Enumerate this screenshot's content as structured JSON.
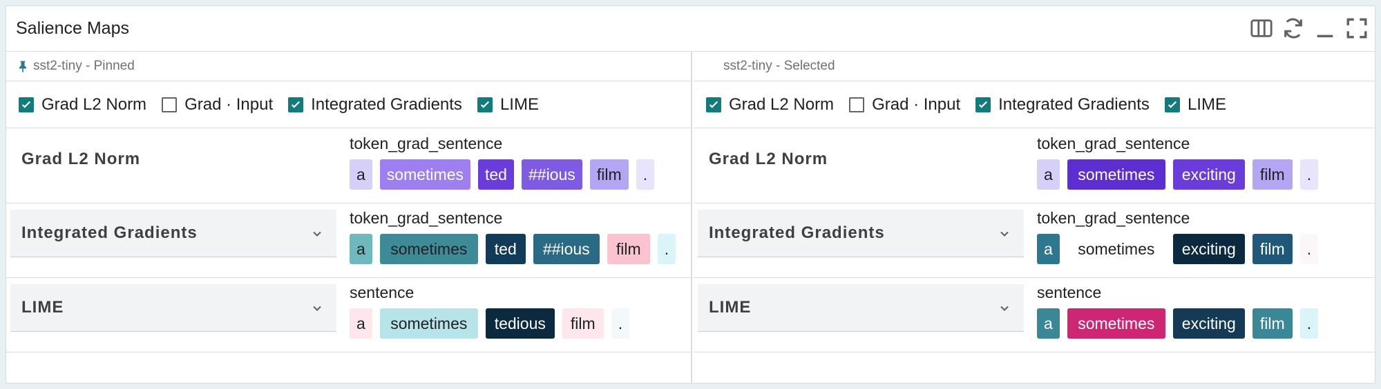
{
  "module": {
    "title": "Salience Maps",
    "toolbar_icons": [
      "columns-icon",
      "refresh-icon",
      "minimize-icon",
      "fullscreen-icon"
    ]
  },
  "panels": [
    {
      "header": "sst2-tiny - Pinned",
      "pinned": true,
      "methods": [
        {
          "label": "Grad L2 Norm",
          "checked": true
        },
        {
          "label": "Grad · Input",
          "checked": false
        },
        {
          "label": "Integrated Gradients",
          "checked": true
        },
        {
          "label": "LIME",
          "checked": true
        }
      ],
      "rows": [
        {
          "method": "Grad L2 Norm",
          "dropdown": false,
          "field": "token_grad_sentence",
          "tokens": [
            {
              "text": "a",
              "bg": "#d6cff8",
              "fg": "#202124",
              "w": 32
            },
            {
              "text": "sometimes",
              "bg": "#9d7ff0",
              "fg": "#ffffff",
              "w": 112
            },
            {
              "text": "ted",
              "bg": "#6a3cd9",
              "fg": "#ffffff",
              "w": 46
            },
            {
              "text": "##ious",
              "bg": "#7f5be4",
              "fg": "#ffffff",
              "w": 78
            },
            {
              "text": "film",
              "bg": "#b5a6f4",
              "fg": "#202124",
              "w": 56
            },
            {
              "text": ".",
              "bg": "#e8e4fb",
              "fg": "#202124",
              "w": 24
            }
          ]
        },
        {
          "method": "Integrated Gradients",
          "dropdown": true,
          "field": "token_grad_sentence",
          "tokens": [
            {
              "text": "a",
              "bg": "#6fb8bd",
              "fg": "#202124",
              "w": 32
            },
            {
              "text": "sometimes",
              "bg": "#3e8b98",
              "fg": "#202124",
              "w": 142
            },
            {
              "text": "ted",
              "bg": "#113b58",
              "fg": "#ffffff",
              "w": 58
            },
            {
              "text": "##ious",
              "bg": "#2a6a85",
              "fg": "#ffffff",
              "w": 96
            },
            {
              "text": "film",
              "bg": "#fac3cf",
              "fg": "#202124",
              "w": 62
            },
            {
              "text": ".",
              "bg": "#dbf4f7",
              "fg": "#202124",
              "w": 24
            }
          ]
        },
        {
          "method": "LIME",
          "dropdown": true,
          "field": "sentence",
          "tokens": [
            {
              "text": "a",
              "bg": "#fde7ec",
              "fg": "#202124",
              "w": 32
            },
            {
              "text": "sometimes",
              "bg": "#b7e4e8",
              "fg": "#202124",
              "w": 142
            },
            {
              "text": "tedious",
              "bg": "#0c2a3f",
              "fg": "#ffffff",
              "w": 100
            },
            {
              "text": "film",
              "bg": "#fde7ec",
              "fg": "#202124",
              "w": 60
            },
            {
              "text": ".",
              "bg": "#f3f9fb",
              "fg": "#202124",
              "w": 24
            }
          ]
        }
      ]
    },
    {
      "header": "sst2-tiny - Selected",
      "pinned": false,
      "methods": [
        {
          "label": "Grad L2 Norm",
          "checked": true
        },
        {
          "label": "Grad · Input",
          "checked": false
        },
        {
          "label": "Integrated Gradients",
          "checked": true
        },
        {
          "label": "LIME",
          "checked": true
        }
      ],
      "rows": [
        {
          "method": "Grad L2 Norm",
          "dropdown": false,
          "field": "token_grad_sentence",
          "tokens": [
            {
              "text": "a",
              "bg": "#d6cff8",
              "fg": "#202124",
              "w": 32
            },
            {
              "text": "sometimes",
              "bg": "#5e2fd0",
              "fg": "#ffffff",
              "w": 142
            },
            {
              "text": "exciting",
              "bg": "#6a3cd9",
              "fg": "#ffffff",
              "w": 104
            },
            {
              "text": "film",
              "bg": "#b5a6f4",
              "fg": "#202124",
              "w": 58
            },
            {
              "text": ".",
              "bg": "#e8e4fb",
              "fg": "#202124",
              "w": 24
            }
          ]
        },
        {
          "method": "Integrated Gradients",
          "dropdown": true,
          "field": "token_grad_sentence",
          "tokens": [
            {
              "text": "a",
              "bg": "#2e7790",
              "fg": "#ffffff",
              "w": 32
            },
            {
              "text": "sometimes",
              "bg": "#ffffff",
              "fg": "#202124",
              "w": 142
            },
            {
              "text": "exciting",
              "bg": "#0c2a3f",
              "fg": "#ffffff",
              "w": 104
            },
            {
              "text": "film",
              "bg": "#1f5878",
              "fg": "#ffffff",
              "w": 58
            },
            {
              "text": ".",
              "bg": "#fbf7f8",
              "fg": "#202124",
              "w": 24
            }
          ]
        },
        {
          "method": "LIME",
          "dropdown": true,
          "field": "sentence",
          "tokens": [
            {
              "text": "a",
              "bg": "#3a8797",
              "fg": "#ffffff",
              "w": 32
            },
            {
              "text": "sometimes",
              "bg": "#cd2675",
              "fg": "#ffffff",
              "w": 142
            },
            {
              "text": "exciting",
              "bg": "#153a55",
              "fg": "#ffffff",
              "w": 104
            },
            {
              "text": "film",
              "bg": "#3a8797",
              "fg": "#ffffff",
              "w": 58
            },
            {
              "text": ".",
              "bg": "#dbf4f7",
              "fg": "#202124",
              "w": 24
            }
          ]
        }
      ]
    }
  ]
}
